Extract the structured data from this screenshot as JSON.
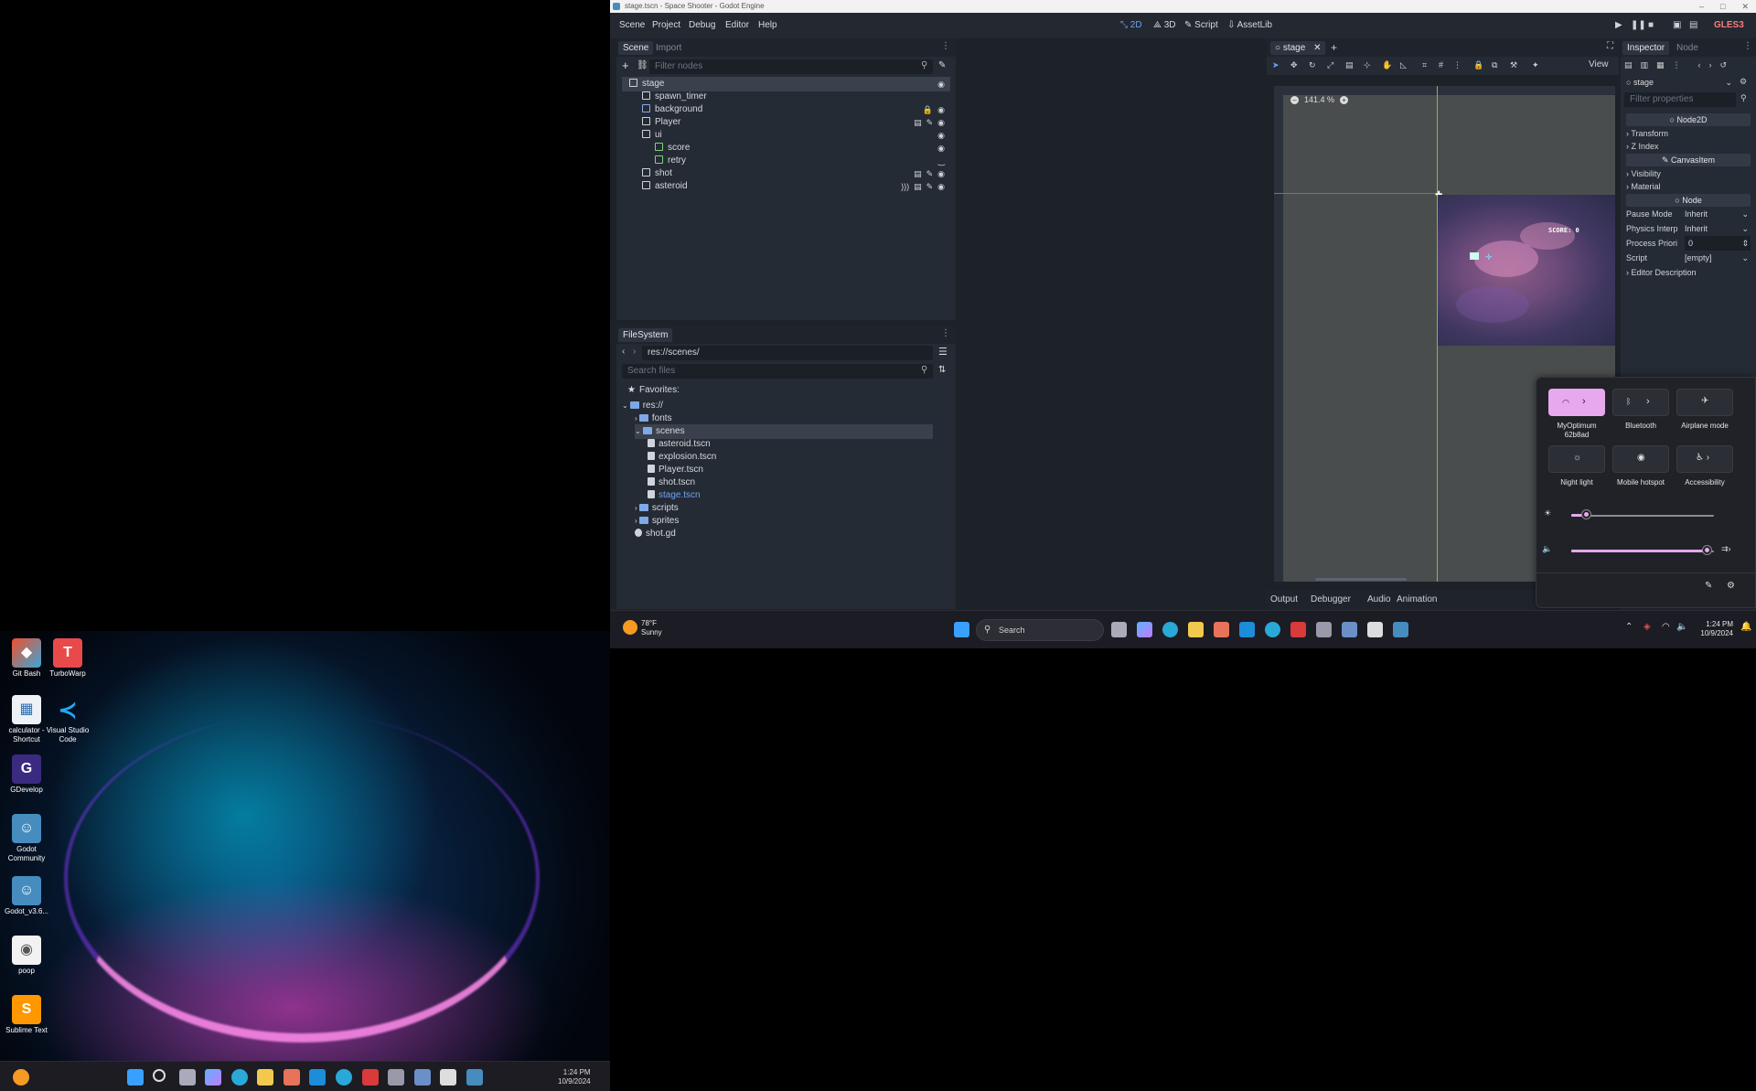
{
  "godot": {
    "window_title": "stage.tscn - Space Shooter - Godot Engine",
    "menus": [
      "Scene",
      "Project",
      "Debug",
      "Editor",
      "Help"
    ],
    "workspaces": [
      "2D",
      "3D",
      "Script",
      "AssetLib"
    ],
    "renderer": "GLES3",
    "scene_dock": {
      "tabs": [
        "Scene",
        "Import"
      ],
      "filter_placeholder": "Filter nodes",
      "nodes": [
        {
          "name": "stage",
          "icon": "node2d-icon",
          "color": "#d4d9e0"
        },
        {
          "name": "spawn_timer",
          "icon": "timer-icon",
          "color": "#d4d9e0"
        },
        {
          "name": "background",
          "icon": "texture-rect-icon",
          "color": "#8aa8f0"
        },
        {
          "name": "Player",
          "icon": "instance-icon",
          "color": "#d4d9e0"
        },
        {
          "name": "ui",
          "icon": "canvas-layer-icon",
          "color": "#d4d9e0"
        },
        {
          "name": "score",
          "icon": "label-icon",
          "color": "#7ed47e"
        },
        {
          "name": "retry",
          "icon": "label-icon",
          "color": "#7ed47e"
        },
        {
          "name": "shot",
          "icon": "instance-icon",
          "color": "#d4d9e0"
        },
        {
          "name": "asteroid",
          "icon": "instance-icon",
          "color": "#d4d9e0"
        }
      ]
    },
    "filesystem": {
      "tab": "FileSystem",
      "path": "res://scenes/",
      "search_placeholder": "Search files",
      "favorites": "Favorites:",
      "root": "res://",
      "items": [
        {
          "label": "fonts",
          "type": "folder",
          "depth": 1
        },
        {
          "label": "scenes",
          "type": "folder",
          "depth": 1
        },
        {
          "label": "asteroid.tscn",
          "type": "file",
          "depth": 2
        },
        {
          "label": "explosion.tscn",
          "type": "file",
          "depth": 2
        },
        {
          "label": "Player.tscn",
          "type": "file",
          "depth": 2
        },
        {
          "label": "shot.tscn",
          "type": "file",
          "depth": 2
        },
        {
          "label": "stage.tscn",
          "type": "file",
          "depth": 2
        },
        {
          "label": "scripts",
          "type": "folder",
          "depth": 1
        },
        {
          "label": "sprites",
          "type": "folder",
          "depth": 1
        },
        {
          "label": "shot.gd",
          "type": "script",
          "depth": 1
        }
      ]
    },
    "viewport": {
      "tab": "stage",
      "view_menu": "View",
      "zoom": "141.4 %",
      "score_text": "SCORE: 0"
    },
    "inspector": {
      "tabs": [
        "Inspector",
        "Node"
      ],
      "object": "stage",
      "filter_placeholder": "Filter properties",
      "sections": {
        "node2d": "Node2D",
        "transform": "Transform",
        "z_index": "Z Index",
        "canvas_item": "CanvasItem",
        "visibility": "Visibility",
        "material": "Material",
        "node": "Node",
        "editor_description": "Editor Description"
      },
      "props": {
        "pause_mode": {
          "label": "Pause Mode",
          "value": "Inherit"
        },
        "physics_interp": {
          "label": "Physics Interp",
          "value": "Inherit"
        },
        "process_priority": {
          "label": "Process Priori",
          "value": "0"
        },
        "script": {
          "label": "Script",
          "value": "[empty]"
        }
      }
    },
    "bottom_tabs": [
      "Output",
      "Debugger",
      "Audio",
      "Animation"
    ]
  },
  "quick_settings": {
    "wifi": {
      "name": "MyOptimum",
      "sub": "62b8ad"
    },
    "bluetooth": "Bluetooth",
    "airplane": "Airplane mode",
    "night_light": "Night light",
    "hotspot": "Mobile hotspot",
    "accessibility": "Accessibility",
    "brightness": 0.1,
    "volume": 0.95,
    "accent": "#e7a8ee"
  },
  "taskbar": {
    "weather_temp": "78°F",
    "weather_desc": "Sunny",
    "search_label": "Search",
    "time": "1:24 PM",
    "date": "10/9/2024"
  },
  "left_screen": {
    "desktop_icons": [
      "Git Bash",
      "TurboWarp",
      "calculator - Shortcut",
      "Visual Studio Code",
      "GDevelop",
      "Godot Community",
      "Godot_v3.6...",
      "poop",
      "Sublime Text"
    ],
    "time": "1:24 PM",
    "date": "10/9/2024"
  }
}
